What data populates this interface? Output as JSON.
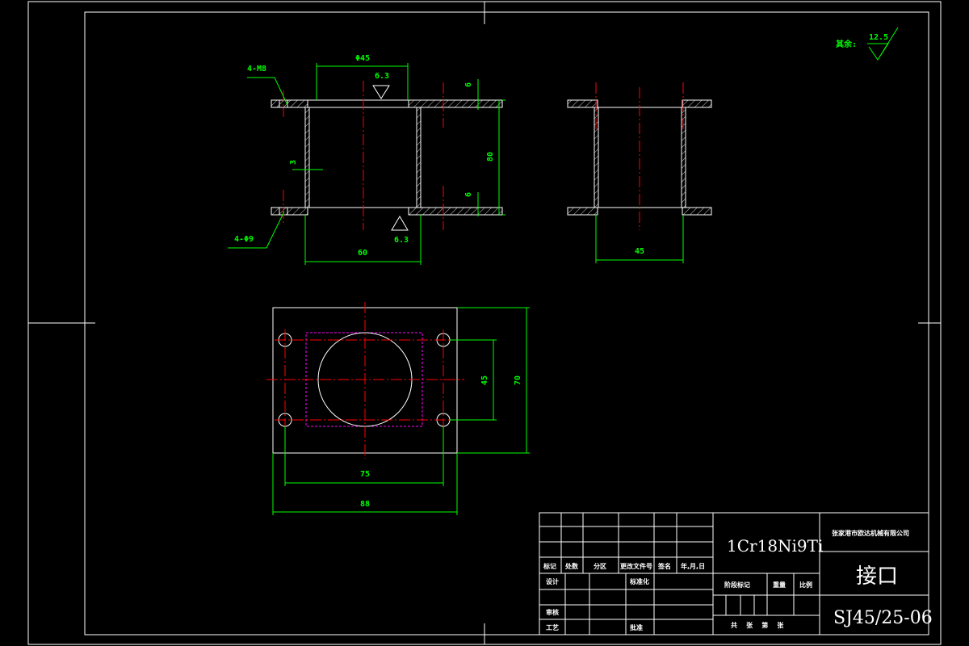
{
  "roughness": {
    "label": "其余:",
    "value": "12.5"
  },
  "front_view": {
    "callout_tapped": "4-M8",
    "callout_holes": "4-Φ9",
    "dim_bore": "Φ45",
    "dim_wall": "3",
    "dim_height": "80",
    "dim_flange_top": "6",
    "dim_flange_bottom": "6",
    "dim_width": "60",
    "rough_top": "6.3",
    "rough_bottom": "6.3"
  },
  "side_view": {
    "dim_width": "45"
  },
  "plan_view": {
    "dim_hole_x": "75",
    "dim_flange_x": "88",
    "dim_hole_y": "45",
    "dim_flange_y": "70"
  },
  "title_block": {
    "material": "1Cr18Ni9Ti",
    "company": "张家港市欧达机械有限公司",
    "part_name": "接口",
    "drawing_no": "SJ45/25-06",
    "headers": [
      "标记",
      "处数",
      "分区",
      "更改文件号",
      "签名",
      "年,月,日"
    ],
    "design": "设计",
    "standardize": "标准化",
    "review": "审核",
    "process": "工艺",
    "approve": "批准",
    "stage": "阶段标记",
    "weight": "重量",
    "scale": "比例",
    "sheet": "共    张    第    张"
  }
}
